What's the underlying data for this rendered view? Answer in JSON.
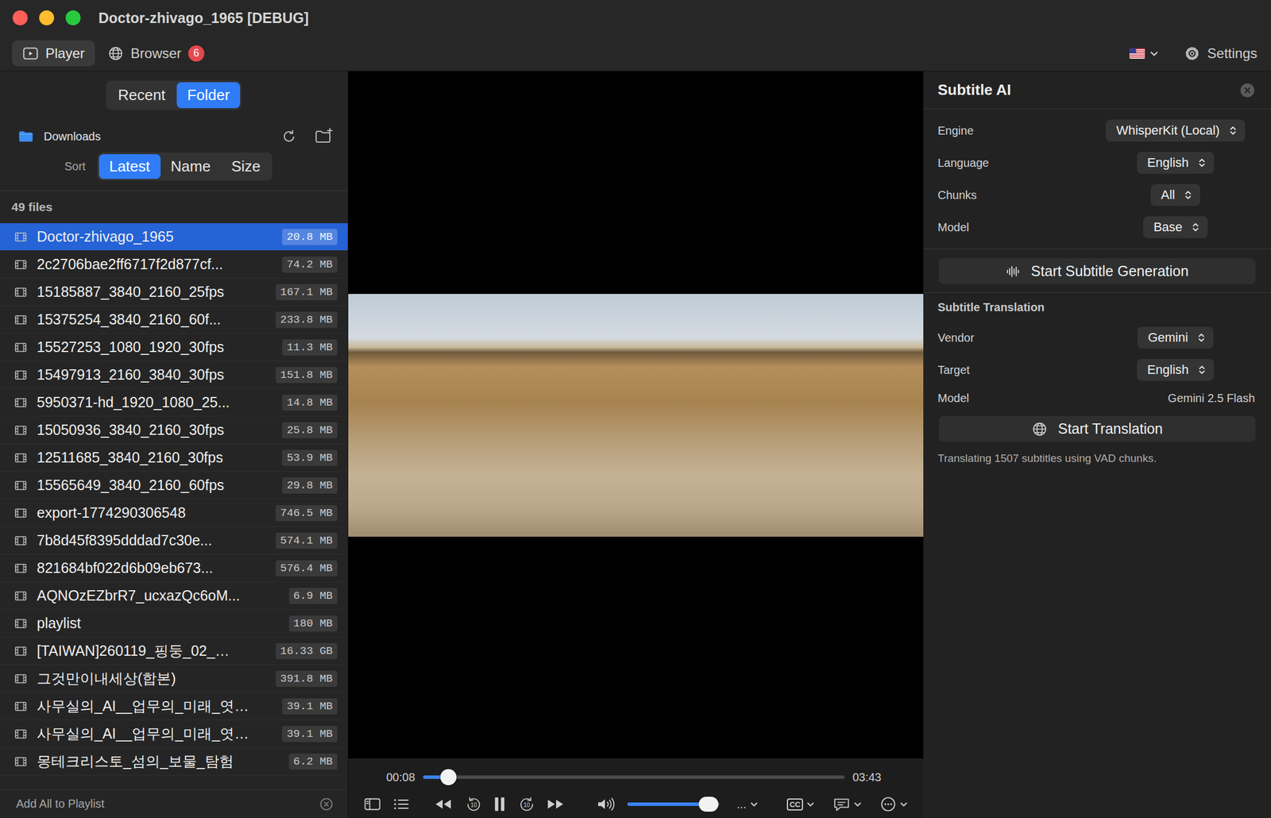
{
  "window": {
    "title": "Doctor-zhivago_1965 [DEBUG]"
  },
  "toolbar": {
    "tabs": [
      {
        "label": "Player",
        "selected": true,
        "badge": ""
      },
      {
        "label": "Browser",
        "selected": false,
        "badge": "6"
      }
    ],
    "settings": "Settings"
  },
  "sidebar": {
    "modes": [
      {
        "label": "Recent",
        "selected": false
      },
      {
        "label": "Folder",
        "selected": true
      }
    ],
    "folder": "Downloads",
    "sort_label": "Sort",
    "sort": [
      {
        "label": "Latest",
        "selected": true
      },
      {
        "label": "Name",
        "selected": false
      },
      {
        "label": "Size",
        "selected": false
      }
    ],
    "count": "49 files",
    "files": [
      {
        "name": "Doctor-zhivago_1965",
        "size": "20.8 MB",
        "selected": true
      },
      {
        "name": "2c2706bae2ff6717f2d877cf...",
        "size": "74.2 MB",
        "selected": false
      },
      {
        "name": "15185887_3840_2160_25fps",
        "size": "167.1 MB",
        "selected": false
      },
      {
        "name": "15375254_3840_2160_60f...",
        "size": "233.8 MB",
        "selected": false
      },
      {
        "name": "15527253_1080_1920_30fps",
        "size": "11.3 MB",
        "selected": false
      },
      {
        "name": "15497913_2160_3840_30fps",
        "size": "151.8 MB",
        "selected": false
      },
      {
        "name": "5950371-hd_1920_1080_25...",
        "size": "14.8 MB",
        "selected": false
      },
      {
        "name": "15050936_3840_2160_30fps",
        "size": "25.8 MB",
        "selected": false
      },
      {
        "name": "12511685_3840_2160_30fps",
        "size": "53.9 MB",
        "selected": false
      },
      {
        "name": "15565649_3840_2160_60fps",
        "size": "29.8 MB",
        "selected": false
      },
      {
        "name": "export-1774290306548",
        "size": "746.5 MB",
        "selected": false
      },
      {
        "name": "7b8d45f8395dddad7c30e...",
        "size": "574.1 MB",
        "selected": false
      },
      {
        "name": "821684bf022d6b09eb673...",
        "size": "576.4 MB",
        "selected": false
      },
      {
        "name": "AQNOzEZbrR7_ucxazQc6oM...",
        "size": "6.9 MB",
        "selected": false
      },
      {
        "name": "playlist",
        "size": "180 MB",
        "selected": false
      },
      {
        "name": "[TAIWAN]260119_핑둥_02_…",
        "size": "16.33 GB",
        "selected": false
      },
      {
        "name": "그것만이내세상(합본)",
        "size": "391.8 MB",
        "selected": false
      },
      {
        "name": "사무실의_AI__업무의_미래_엿…",
        "size": "39.1 MB",
        "selected": false
      },
      {
        "name": "사무실의_AI__업무의_미래_엿…",
        "size": "39.1 MB",
        "selected": false
      },
      {
        "name": "몽테크리스토_섬의_보물_탐험",
        "size": "6.2 MB",
        "selected": false
      }
    ],
    "footer": "Add All to Playlist"
  },
  "player": {
    "current": "00:08",
    "duration": "03:43",
    "progress": 0.06,
    "playing": true,
    "skip_seconds": "10",
    "volume": 0.88,
    "audio_label": "...",
    "cc_label": "CC"
  },
  "panel": {
    "title": "Subtitle AI",
    "fields": [
      {
        "label": "Engine",
        "value": "WhisperKit (Local)"
      },
      {
        "label": "Language",
        "value": "English"
      },
      {
        "label": "Chunks",
        "value": "All"
      },
      {
        "label": "Model",
        "value": "Base"
      }
    ],
    "generate": "Start Subtitle Generation",
    "translation_title": "Subtitle Translation",
    "translation_fields": [
      {
        "label": "Vendor",
        "value": "Gemini",
        "kind": "dropdown"
      },
      {
        "label": "Target",
        "value": "English",
        "kind": "dropdown"
      },
      {
        "label": "Model",
        "value": "Gemini 2.5 Flash",
        "kind": "text"
      }
    ],
    "translate": "Start Translation",
    "status": "Translating 1507 subtitles using VAD chunks."
  }
}
